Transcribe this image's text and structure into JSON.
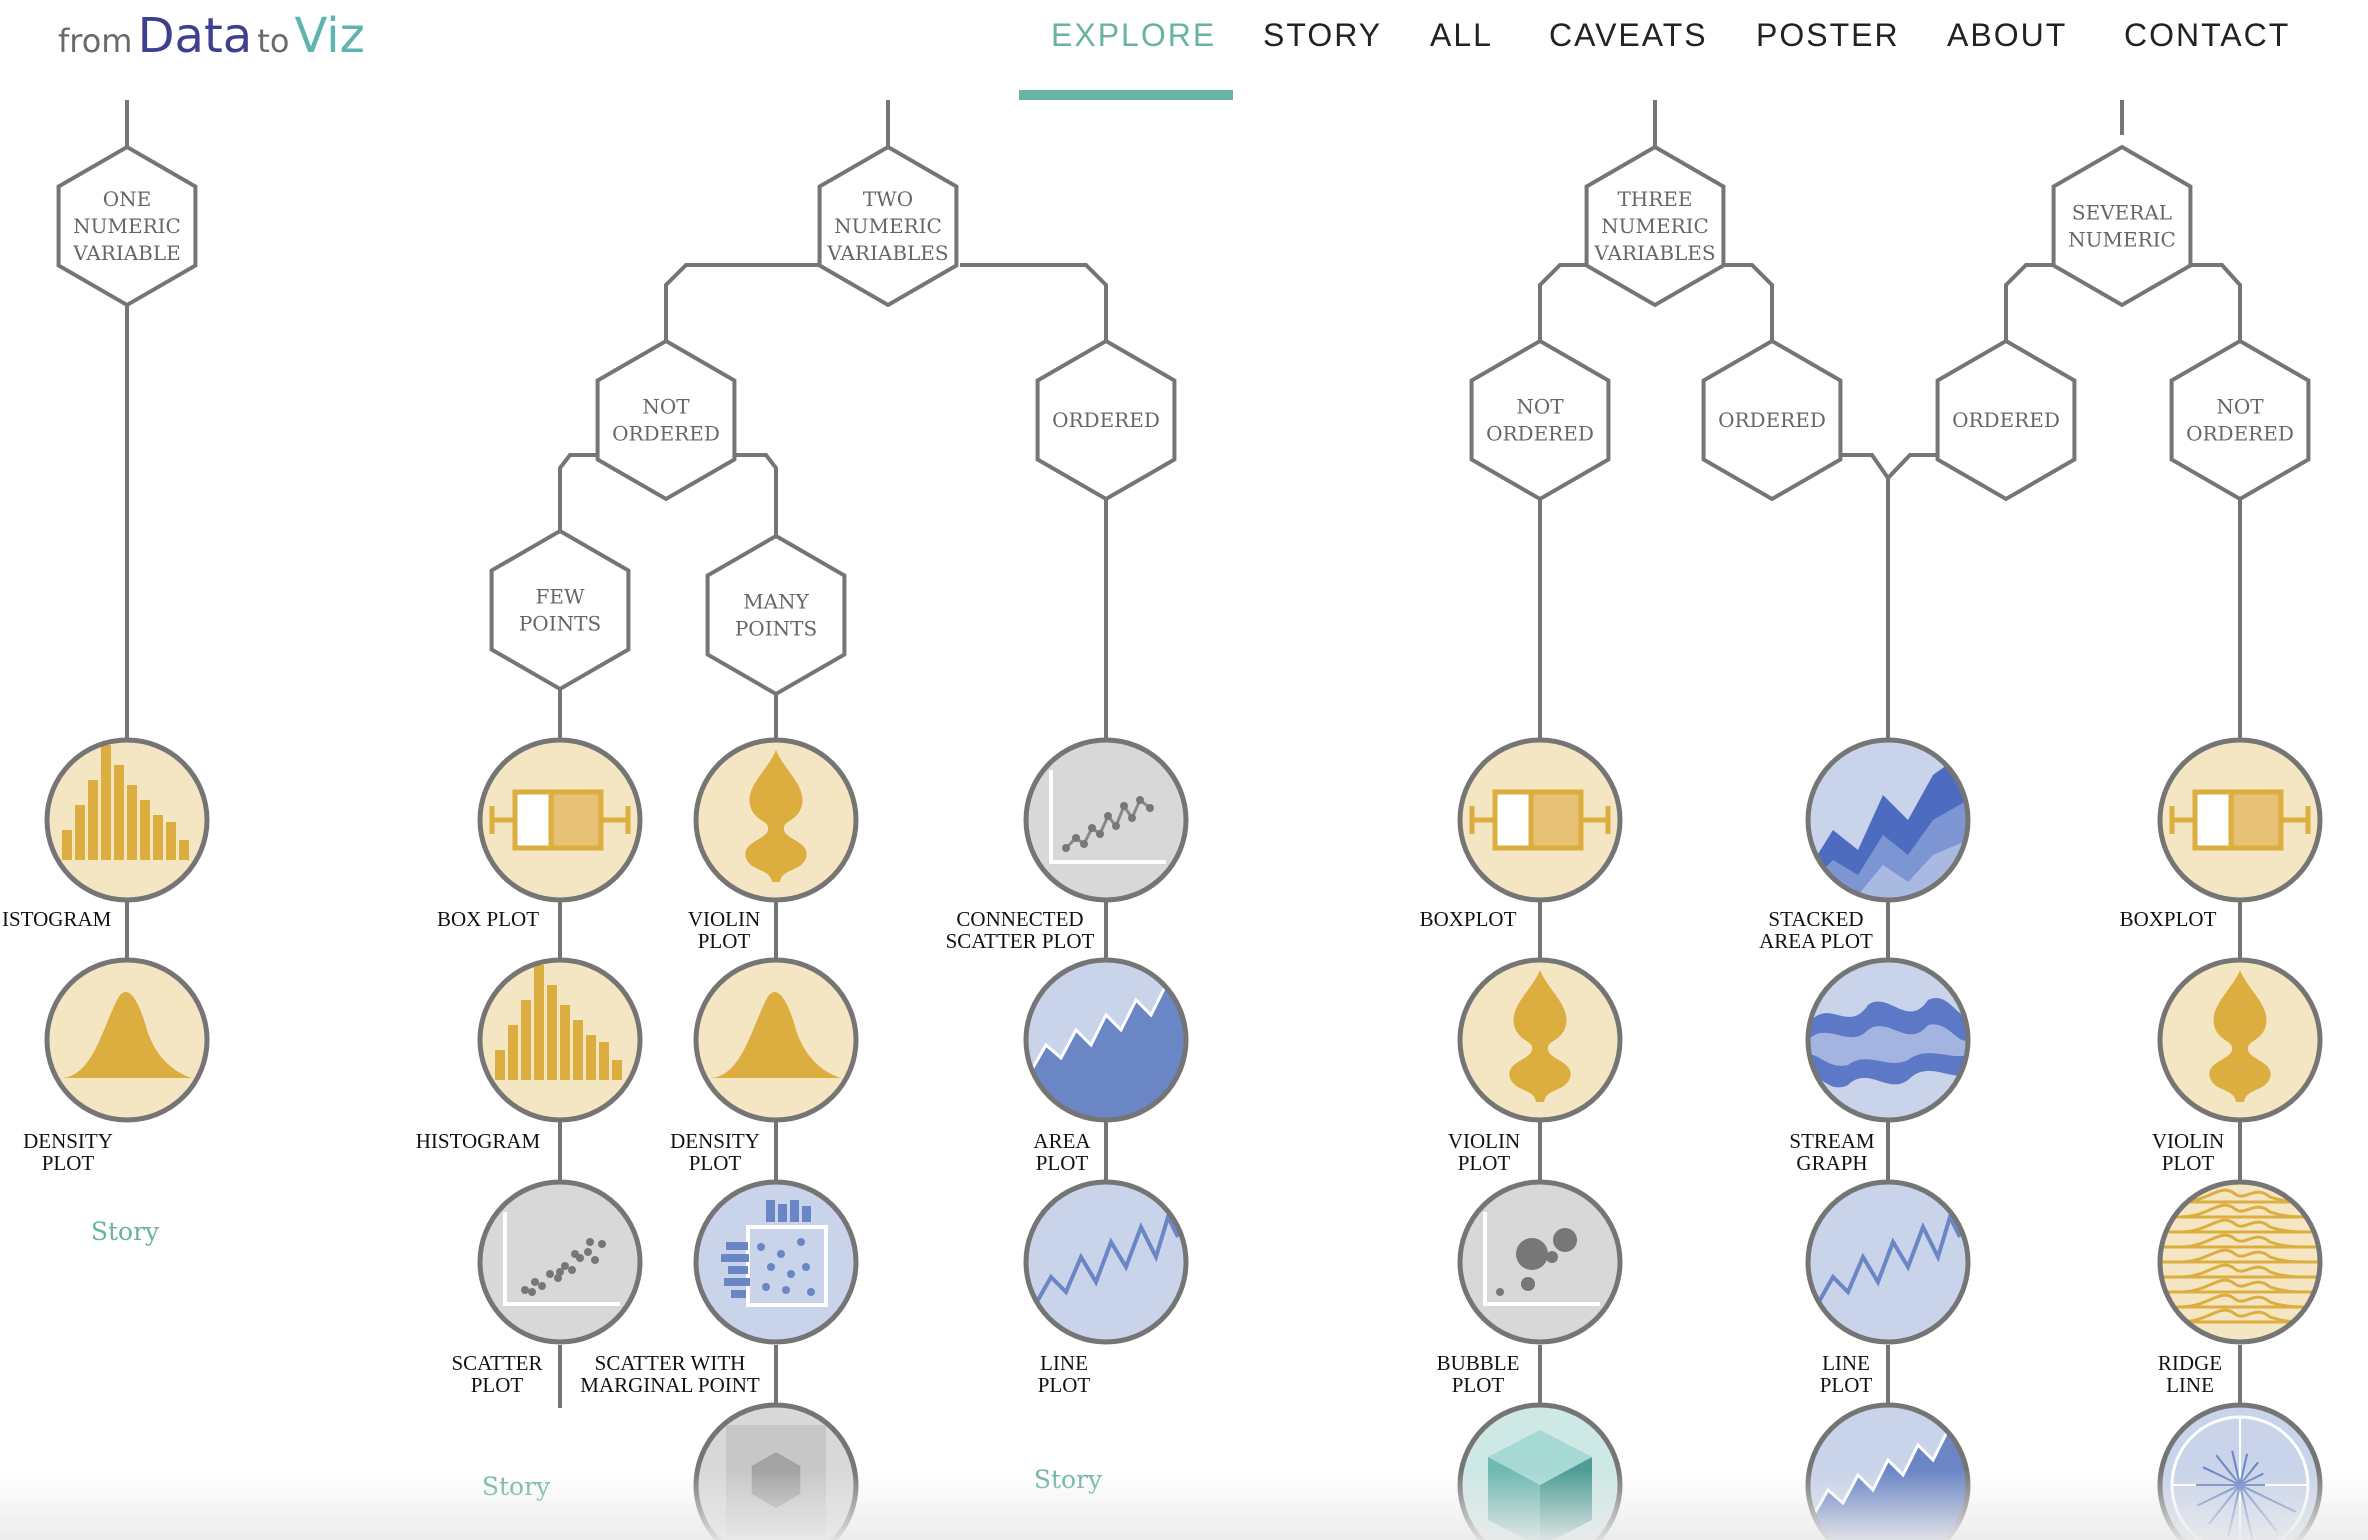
{
  "logo": {
    "from": "from",
    "data": "Data",
    "to": "to",
    "viz": "Viz"
  },
  "nav": {
    "items": [
      {
        "label": "EXPLORE",
        "active": true
      },
      {
        "label": "STORY"
      },
      {
        "label": "ALL"
      },
      {
        "label": "CAVEATS"
      },
      {
        "label": "POSTER"
      },
      {
        "label": "ABOUT"
      },
      {
        "label": "CONTACT"
      }
    ]
  },
  "colors": {
    "accent": "#69b3a2",
    "line": "#757575",
    "yellow_fill": "#f5e6c3",
    "yellow_mark": "#dcae40",
    "blue_fill": "#c9d3ea",
    "blue_mark": "#6a86c5",
    "grey_fill": "#d8d8d8"
  },
  "tree": {
    "nodes": {
      "one_numeric": [
        "ONE",
        "NUMERIC",
        "VARIABLE"
      ],
      "two_numeric": [
        "TWO",
        "NUMERIC",
        "VARIABLES"
      ],
      "two_not_ordered": [
        "NOT",
        "ORDERED"
      ],
      "two_ordered": [
        "ORDERED"
      ],
      "few_points": [
        "FEW",
        "POINTS"
      ],
      "many_points": [
        "MANY",
        "POINTS"
      ],
      "three_numeric": [
        "THREE",
        "NUMERIC",
        "VARIABLES"
      ],
      "three_not_ordered": [
        "NOT",
        "ORDERED"
      ],
      "three_ordered": [
        "ORDERED"
      ],
      "several_numeric": [
        "SEVERAL",
        "NUMERIC"
      ],
      "several_ordered": [
        "ORDERED"
      ],
      "several_not_ordered": [
        "NOT",
        "ORDERED"
      ]
    },
    "charts": {
      "one_histogram": {
        "label": [
          "ISTOGRAM"
        ],
        "icon": "histogram-icon"
      },
      "one_density": {
        "label": [
          "DENSITY",
          "PLOT"
        ],
        "icon": "density-icon"
      },
      "few_boxplot": {
        "label": [
          "BOX PLOT"
        ],
        "icon": "boxplot-icon"
      },
      "few_histogram": {
        "label": [
          "HISTOGRAM"
        ],
        "icon": "histogram-icon"
      },
      "few_scatter": {
        "label": [
          "SCATTER",
          "PLOT"
        ],
        "icon": "scatter-icon"
      },
      "many_violin": {
        "label": [
          "VIOLIN",
          "PLOT"
        ],
        "icon": "violin-icon"
      },
      "many_density": {
        "label": [
          "DENSITY",
          "PLOT"
        ],
        "icon": "density-icon"
      },
      "many_marginal": {
        "label": [
          "SCATTER WITH",
          "MARGINAL POINT"
        ],
        "icon": "marginal-scatter-icon"
      },
      "many_hexbin": {
        "label": [],
        "icon": "hexbin-icon"
      },
      "ord_connected": {
        "label": [
          "CONNECTED",
          "SCATTER PLOT"
        ],
        "icon": "connected-scatter-icon"
      },
      "ord_area": {
        "label": [
          "AREA",
          "PLOT"
        ],
        "icon": "area-icon"
      },
      "ord_line": {
        "label": [
          "LINE",
          "PLOT"
        ],
        "icon": "line-icon"
      },
      "three_boxplot": {
        "label": [
          "BOXPLOT"
        ],
        "icon": "boxplot-icon"
      },
      "three_violin": {
        "label": [
          "VIOLIN",
          "PLOT"
        ],
        "icon": "violin-icon"
      },
      "three_bubble": {
        "label": [
          "BUBBLE",
          "PLOT"
        ],
        "icon": "bubble-icon"
      },
      "three_3d": {
        "label": [],
        "icon": "cube-icon"
      },
      "mid_stacked": {
        "label": [
          "STACKED",
          "AREA PLOT"
        ],
        "icon": "stacked-area-icon"
      },
      "mid_stream": {
        "label": [
          "STREAM",
          "GRAPH"
        ],
        "icon": "streamgraph-icon"
      },
      "mid_line": {
        "label": [
          "LINE",
          "PLOT"
        ],
        "icon": "line-icon"
      },
      "mid_area": {
        "label": [],
        "icon": "area-icon"
      },
      "sev_boxplot": {
        "label": [
          "BOXPLOT"
        ],
        "icon": "boxplot-icon"
      },
      "sev_violin": {
        "label": [
          "VIOLIN",
          "PLOT"
        ],
        "icon": "violin-icon"
      },
      "sev_ridge": {
        "label": [
          "RIDGE",
          "LINE"
        ],
        "icon": "ridgeline-icon"
      },
      "sev_radar": {
        "label": [],
        "icon": "radar-icon"
      }
    },
    "stories": {
      "one": "Story",
      "few": "Story",
      "ordered": "Story"
    }
  }
}
